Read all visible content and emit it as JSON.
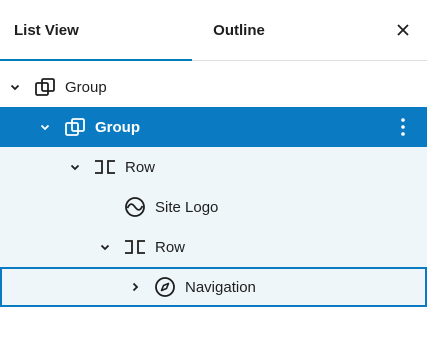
{
  "tabs": {
    "list_view": "List View",
    "outline": "Outline",
    "active": "list_view"
  },
  "close_icon": "close-icon",
  "accent_color": "#0a7bc2",
  "tree": [
    {
      "label": "Group",
      "icon": "group-icon",
      "expanded": true,
      "state": "normal"
    },
    {
      "label": "Group",
      "icon": "group-icon",
      "expanded": true,
      "state": "selected"
    },
    {
      "label": "Row",
      "icon": "row-icon",
      "expanded": true,
      "state": "tinted"
    },
    {
      "label": "Site Logo",
      "icon": "site-logo-icon",
      "state": "tinted"
    },
    {
      "label": "Row",
      "icon": "row-icon",
      "expanded": true,
      "state": "tinted"
    },
    {
      "label": "Navigation",
      "icon": "navigation-icon",
      "expanded": false,
      "state": "focused"
    }
  ]
}
